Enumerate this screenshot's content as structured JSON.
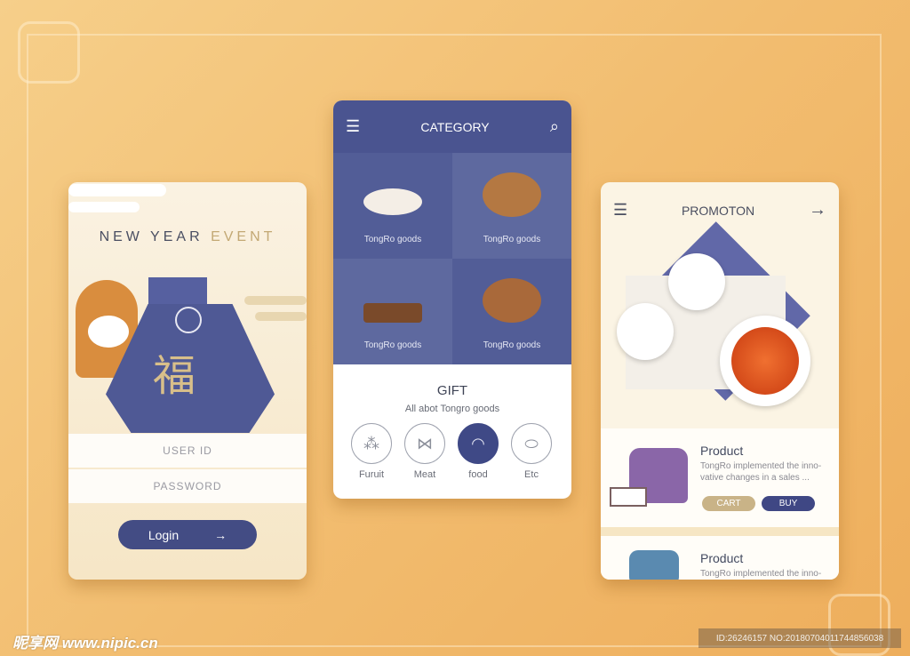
{
  "login_card": {
    "title_a": "NEW YEAR",
    "title_b": "EVENT",
    "glyph": "福",
    "user_id": "USER ID",
    "password": "PASSWORD",
    "login": "Login"
  },
  "category_card": {
    "title": "CATEGORY",
    "tiles": [
      {
        "label": "TongRo goods"
      },
      {
        "label": "TongRo goods"
      },
      {
        "label": "TongRo goods"
      },
      {
        "label": "TongRo goods"
      }
    ],
    "gift_title": "GIFT",
    "gift_sub": "All abot Tongro goods",
    "categories": [
      {
        "label": "Furuit",
        "icon": "grapes-icon"
      },
      {
        "label": "Meat",
        "icon": "fish-icon"
      },
      {
        "label": "food",
        "icon": "bun-icon",
        "selected": true
      },
      {
        "label": "Etc",
        "icon": "steak-icon"
      }
    ]
  },
  "promo_card": {
    "title": "PROMOTON",
    "products": [
      {
        "name": "Product",
        "desc": "TongRo implemented the inno-vative changes in a sales ...",
        "cart": "CART",
        "buy": "BUY"
      },
      {
        "name": "Product",
        "desc": "TongRo implemented the inno-"
      }
    ]
  },
  "watermark": {
    "site": "昵享网 www.nipic.cn",
    "id": "ID:26246157 NO:20180704011744856038"
  },
  "colors": {
    "navy": "#434c84",
    "gold": "#c8b180",
    "bg": "#f2bd70"
  }
}
